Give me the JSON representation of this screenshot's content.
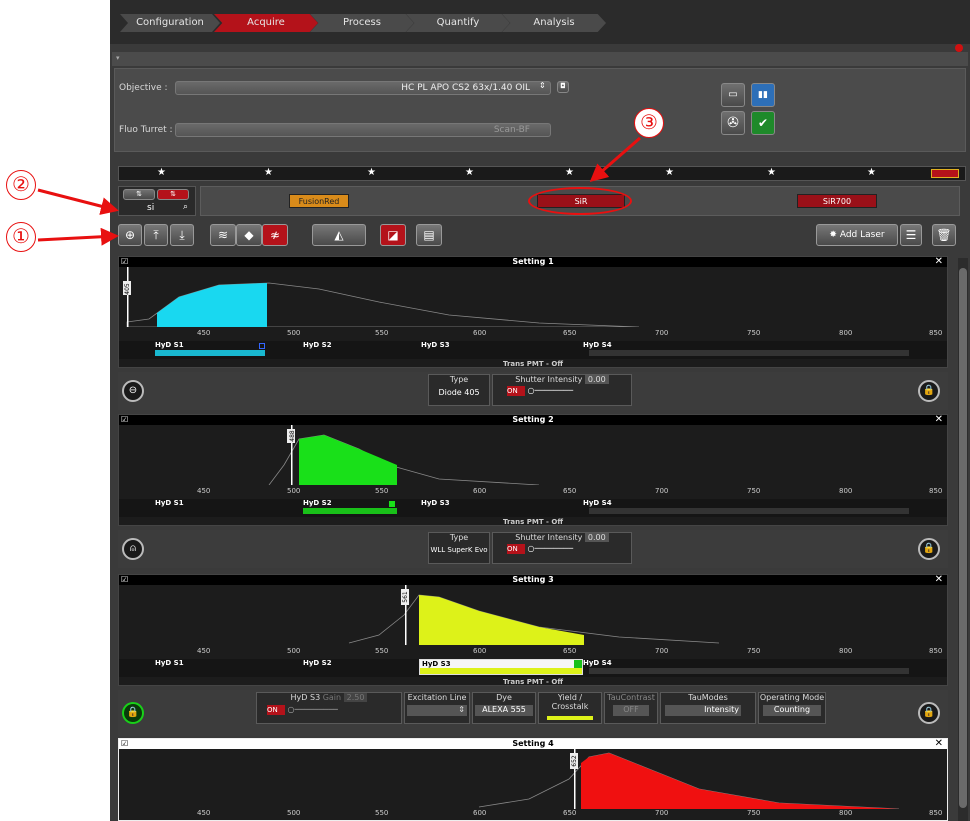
{
  "tabs": [
    "Configuration",
    "Acquire",
    "Process",
    "Quantify",
    "Analysis"
  ],
  "objective_label": "Objective :",
  "objective_value": "HC PL APO CS2   63x/1.40 OIL",
  "turret_label": "Fluo Turret :",
  "turret_value": "Scan-BF",
  "search_value": "si",
  "dyes": [
    {
      "name": "FusionRed",
      "color": "#d98b1a"
    },
    {
      "name": "SiR",
      "color": "#9a1018"
    },
    {
      "name": "SiR700",
      "color": "#9a1018"
    }
  ],
  "add_laser_label": "Add Laser",
  "annotations": [
    "①",
    "②",
    "③"
  ],
  "axis_ticks": [
    "450",
    "500",
    "550",
    "600",
    "650",
    "700",
    "750",
    "800",
    "850"
  ],
  "detectors": [
    "HyD S1",
    "HyD S2",
    "HyD S3",
    "HyD S4"
  ],
  "trans_label": "Trans PMT - Off",
  "settings": [
    {
      "title": "Setting 1",
      "line": "405",
      "color": "#19d8f0"
    },
    {
      "title": "Setting 2",
      "line": "488",
      "color": "#19e019"
    },
    {
      "title": "Setting 3",
      "line": "561",
      "color": "#ddf219"
    },
    {
      "title": "Setting 4",
      "line": "652",
      "color": "#f01010"
    }
  ],
  "ctrl1": {
    "type_label": "Type",
    "type_value": "Diode 405",
    "shutter": "Shutter",
    "intensity": "Intensity",
    "intensity_value": "0.00",
    "on": "ON"
  },
  "ctrl2": {
    "type_label": "Type",
    "type_value": "WLL SuperK Evo",
    "shutter": "Shutter",
    "intensity": "Intensity",
    "intensity_value": "0.00",
    "on": "ON"
  },
  "ctrl3": {
    "det": "HyD S3",
    "gain": "Gain",
    "gain_value": "2.50",
    "on": "ON",
    "excitation": "Excitation Line",
    "dye": "Dye",
    "dye_value": "ALEXA 555",
    "yield": "Yield / Crosstalk",
    "tau": "TauContrast",
    "tau_off": "OFF",
    "taumodes": "TauModes",
    "taumodes_value": "Intensity",
    "opmode": "Operating Mode",
    "opmode_value": "Counting"
  }
}
